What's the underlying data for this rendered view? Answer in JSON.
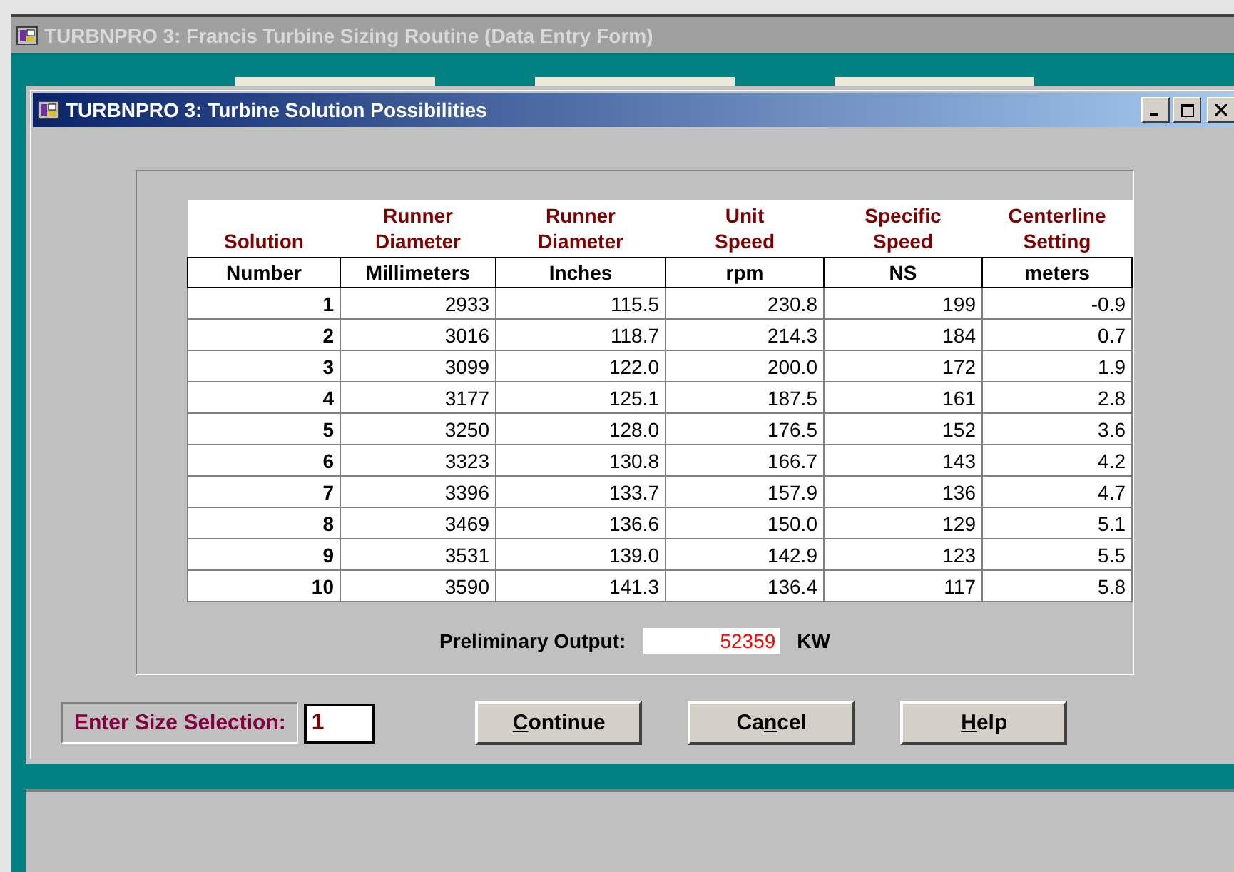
{
  "back_window": {
    "title": "TURBNPRO 3: Francis Turbine Sizing Routine (Data Entry Form)",
    "active": false
  },
  "dialog": {
    "title": "TURBNPRO 3: Turbine Solution Possibilities",
    "active": true
  },
  "table": {
    "columns": [
      {
        "bottom": "Solution",
        "unit": "Number"
      },
      {
        "top": "Runner",
        "bottom": "Diameter",
        "unit": "Millimeters"
      },
      {
        "top": "Runner",
        "bottom": "Diameter",
        "unit": "Inches"
      },
      {
        "top": "Unit",
        "bottom": "Speed",
        "unit": "rpm"
      },
      {
        "top": "Specific",
        "bottom": "Speed",
        "unit": "NS"
      },
      {
        "top": "Centerline",
        "bottom": "Setting",
        "unit": "meters"
      }
    ],
    "rows": [
      [
        "1",
        "2933",
        "115.5",
        "230.8",
        "199",
        "-0.9"
      ],
      [
        "2",
        "3016",
        "118.7",
        "214.3",
        "184",
        "0.7"
      ],
      [
        "3",
        "3099",
        "122.0",
        "200.0",
        "172",
        "1.9"
      ],
      [
        "4",
        "3177",
        "125.1",
        "187.5",
        "161",
        "2.8"
      ],
      [
        "5",
        "3250",
        "128.0",
        "176.5",
        "152",
        "3.6"
      ],
      [
        "6",
        "3323",
        "130.8",
        "166.7",
        "143",
        "4.2"
      ],
      [
        "7",
        "3396",
        "133.7",
        "157.9",
        "136",
        "4.7"
      ],
      [
        "8",
        "3469",
        "136.6",
        "150.0",
        "129",
        "5.1"
      ],
      [
        "9",
        "3531",
        "139.0",
        "142.9",
        "123",
        "5.5"
      ],
      [
        "10",
        "3590",
        "141.3",
        "136.4",
        "117",
        "5.8"
      ]
    ]
  },
  "output": {
    "label": "Preliminary Output:",
    "value": "52359",
    "unit": "KW"
  },
  "selection": {
    "label": "Enter Size Selection:",
    "value": "1"
  },
  "buttons": [
    {
      "key": "C",
      "post": "ontinue"
    },
    {
      "pre": "Ca",
      "key": "n",
      "post": "cel"
    },
    {
      "key": "H",
      "post": "elp"
    }
  ]
}
